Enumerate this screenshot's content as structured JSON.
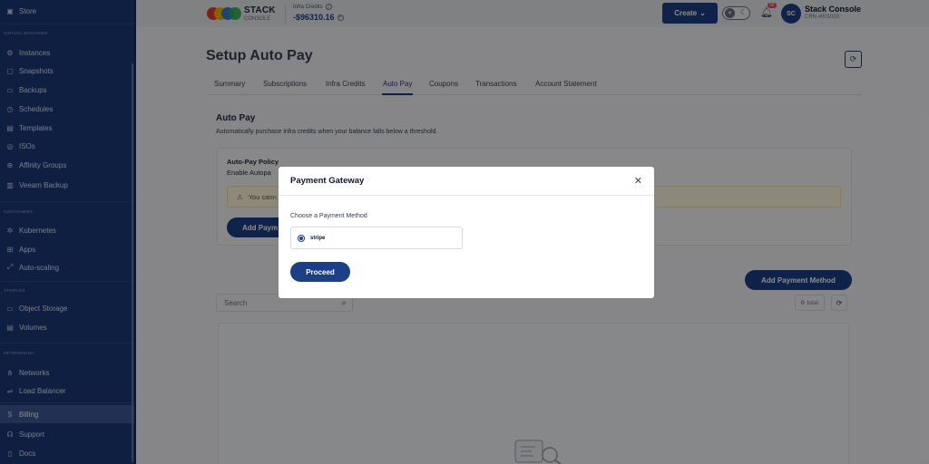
{
  "sidebar": {
    "sections": {
      "virtual_machines": "VIRTUAL MACHINES",
      "containers": "CONTAINERS",
      "storage": "STORAGE",
      "networking": "NETWORKING"
    },
    "items": {
      "store": "Store",
      "instances": "Instances",
      "snapshots": "Snapshots",
      "backups": "Backups",
      "schedules": "Schedules",
      "templates": "Templates",
      "isos": "ISOs",
      "affinity_groups": "Affinity Groups",
      "veeam_backup": "Veeam Backup",
      "kubernetes": "Kubernetes",
      "apps": "Apps",
      "auto_scaling": "Auto-scaling",
      "object_storage": "Object Storage",
      "volumes": "Volumes",
      "networks": "Networks",
      "load_balancer": "Load Balancer",
      "billing": "Billing",
      "support": "Support",
      "docs": "Docs"
    },
    "active": "billing"
  },
  "header": {
    "logo_line1": "STACK",
    "logo_line2": "CONSOLE",
    "credits_label": "Infra Credits",
    "credits_value": "-$96310.16",
    "create_label": "Create",
    "notification_count": "99",
    "avatar_initials": "SC",
    "user_name": "Stack Console",
    "user_id": "CRN #001020"
  },
  "page": {
    "title": "Setup Auto Pay",
    "tabs": [
      "Summary",
      "Subscriptions",
      "Infra Credits",
      "Auto Pay",
      "Coupons",
      "Transactions",
      "Account Statement"
    ],
    "active_tab": "Auto Pay",
    "section_title": "Auto Pay",
    "section_desc": "Automatically purchase infra credits when your balance falls below a threshold.",
    "policy_title": "Auto-Pay Policy",
    "policy_desc": "Enable Autopa",
    "warning_text": "You cann",
    "add_payment_partial": "Add Paym",
    "add_payment_method": "Add Payment Method",
    "search_placeholder": "Search",
    "total_count": "0",
    "total_label": "total"
  },
  "modal": {
    "title": "Payment Gateway",
    "choose_label": "Choose a Payment Method",
    "option": "stripe",
    "proceed": "Proceed"
  },
  "colors": {
    "sidebar_bg": "#1a3a78",
    "primary": "#1d3f86",
    "warning_bg": "#fff7e0"
  }
}
